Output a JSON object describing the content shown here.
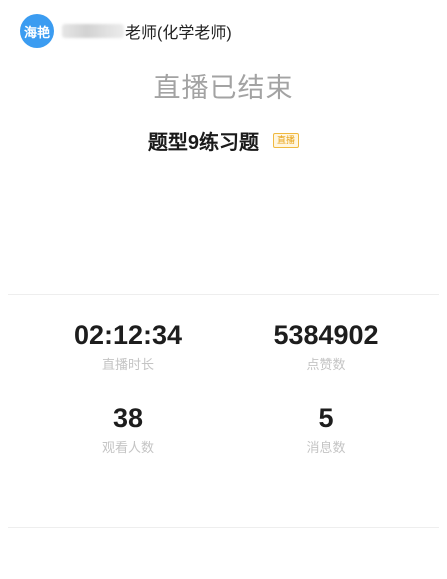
{
  "header": {
    "avatar_text": "海艳",
    "teacher_name": "老师(化学老师)"
  },
  "status": {
    "title": "直播已结束"
  },
  "lesson": {
    "title": "题型9练习题",
    "badge": "直播"
  },
  "stats": [
    {
      "value": "02:12:34",
      "label": "直播时长"
    },
    {
      "value": "5384902",
      "label": "点赞数"
    },
    {
      "value": "38",
      "label": "观看人数"
    },
    {
      "value": "5",
      "label": "消息数"
    }
  ],
  "colors": {
    "avatar_bg": "#3b9cf1",
    "status_text": "#a3a3a3",
    "badge": "#e8a317"
  }
}
